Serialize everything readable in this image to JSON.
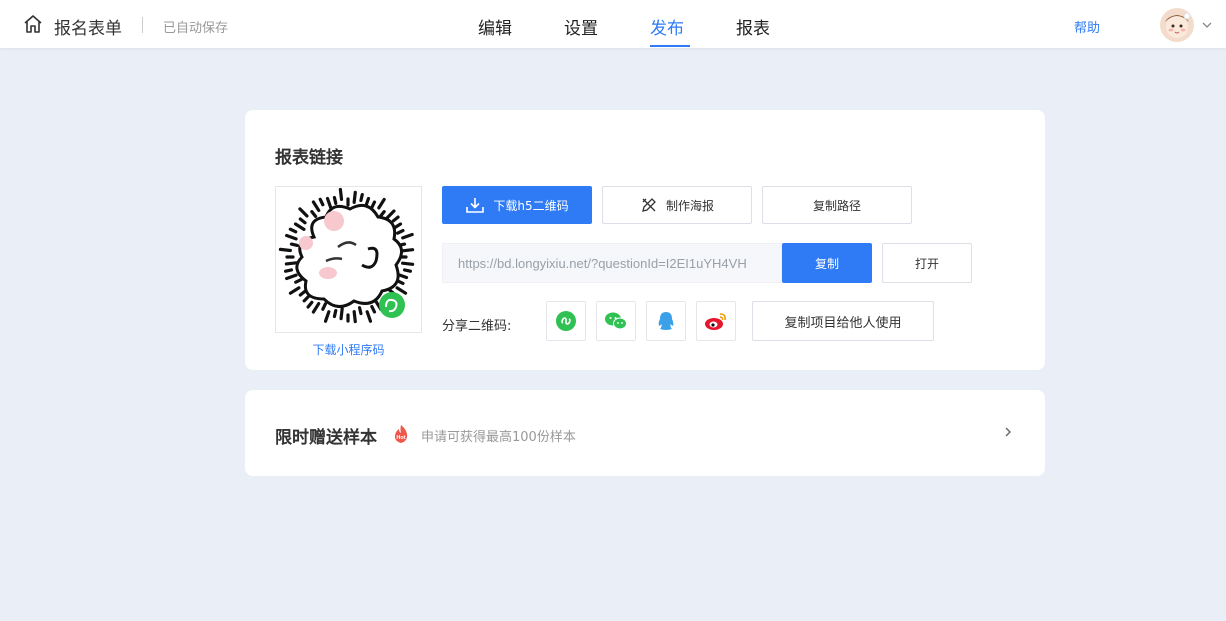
{
  "header": {
    "app_title": "报名表单",
    "save_status": "已自动保存",
    "tabs": [
      {
        "label": "编辑",
        "active": false
      },
      {
        "label": "设置",
        "active": false
      },
      {
        "label": "发布",
        "active": true
      },
      {
        "label": "报表",
        "active": false
      }
    ],
    "help_label": "帮助",
    "accent_color": "#2f7bf5"
  },
  "link_card": {
    "title": "报表链接",
    "qr_download_label": "下载小程序码",
    "buttons": {
      "download_h5_qr": "下载h5二维码",
      "make_poster": "制作海报",
      "copy_path": "复制路径"
    },
    "url_value": "https://bd.longyixiu.net/?questionId=I2EI1uYH4VH",
    "copy_label": "复制",
    "open_label": "打开",
    "share_label": "分享二维码:",
    "share_icons": [
      "miniprogram-icon",
      "wechat-icon",
      "qq-icon",
      "weibo-icon"
    ],
    "copy_project_label": "复制项目给他人使用"
  },
  "sample_card": {
    "title": "限时赠送样本",
    "hot_badge": "Hot",
    "description": "申请可获得最高100份样本"
  }
}
